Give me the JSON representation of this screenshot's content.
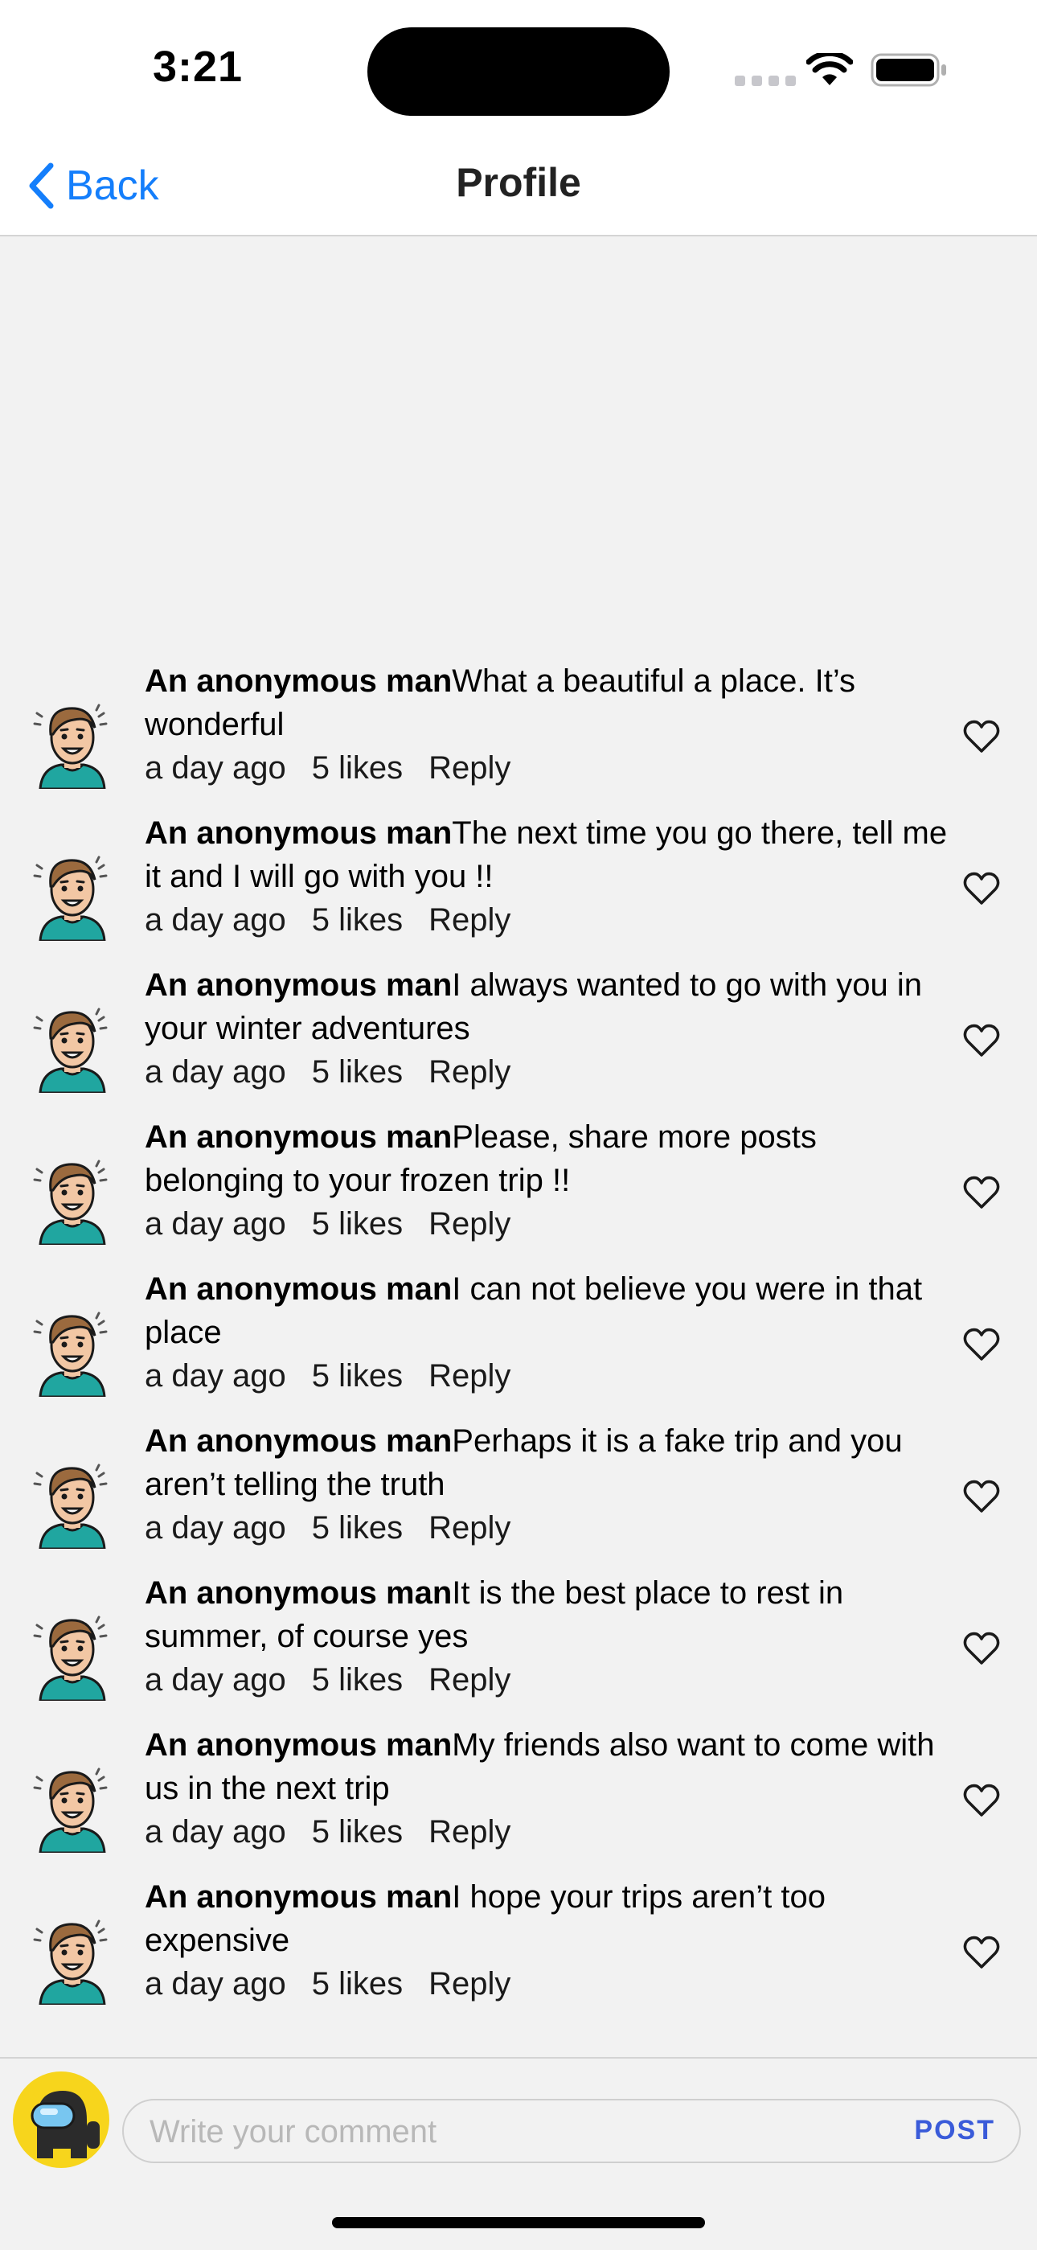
{
  "status_bar": {
    "time": "3:21"
  },
  "nav": {
    "back_label": "Back",
    "title": "Profile"
  },
  "comments": [
    {
      "author": "An anonymous man",
      "text": "What a beautiful a place. It’s wonderful",
      "time": "a day ago",
      "likes": "5 likes",
      "reply": "Reply"
    },
    {
      "author": "An anonymous man",
      "text": "The next time you go there, tell me it and I will go with you !!",
      "time": "a day ago",
      "likes": "5 likes",
      "reply": "Reply"
    },
    {
      "author": "An anonymous man",
      "text": "I always wanted to go with you in your winter adventures",
      "time": "a day ago",
      "likes": "5 likes",
      "reply": "Reply"
    },
    {
      "author": "An anonymous man",
      "text": "Please, share more posts belonging to your frozen trip !!",
      "time": "a day ago",
      "likes": "5 likes",
      "reply": "Reply"
    },
    {
      "author": "An anonymous man",
      "text": "I can not believe you were in that place",
      "time": "a day ago",
      "likes": "5 likes",
      "reply": "Reply"
    },
    {
      "author": "An anonymous man",
      "text": "Perhaps it is a fake trip and you aren’t telling the truth",
      "time": "a day ago",
      "likes": "5 likes",
      "reply": "Reply"
    },
    {
      "author": "An anonymous man",
      "text": "It is the best place to rest in summer, of course yes",
      "time": "a day ago",
      "likes": "5 likes",
      "reply": "Reply"
    },
    {
      "author": "An anonymous man",
      "text": "My friends also want to come with us in the next trip",
      "time": "a day ago",
      "likes": "5 likes",
      "reply": "Reply"
    },
    {
      "author": "An anonymous man",
      "text": "I hope your trips aren’t too expensive",
      "time": "a day ago",
      "likes": "5 likes",
      "reply": "Reply"
    }
  ],
  "composer": {
    "placeholder": "Write your comment",
    "post_label": "POST"
  },
  "colors": {
    "accent": "#147efb",
    "post": "#3a5bd9",
    "avatar_bg": "#f7d51c"
  },
  "icons": {
    "back": "chevron-left-icon",
    "like": "heart-outline-icon",
    "user_avatar": "among-us-crewmate-icon"
  }
}
